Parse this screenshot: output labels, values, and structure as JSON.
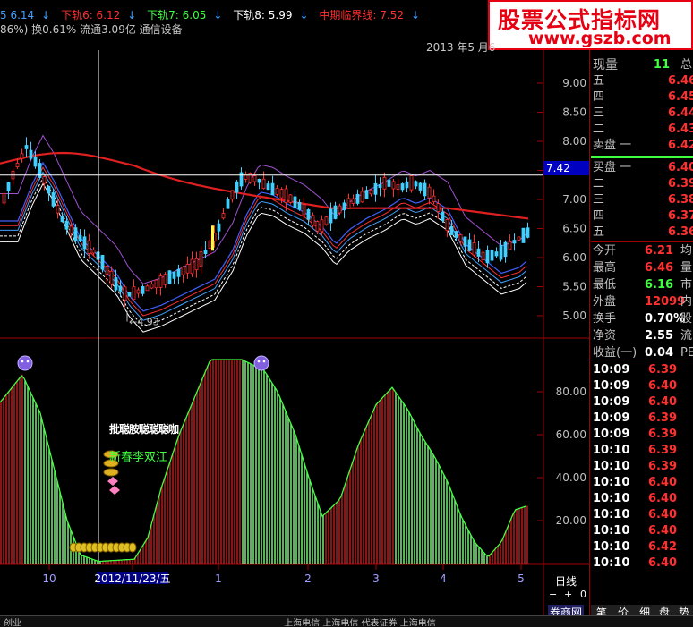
{
  "indicators": [
    {
      "text": "5 6.14",
      "color": "#40a0ff"
    },
    {
      "text": "下轨6: 6.12",
      "color": "#ff3030"
    },
    {
      "text": "下轨7: 6.05",
      "color": "#40ff40"
    },
    {
      "text": "下轨8: 5.99",
      "color": "#ffffff"
    },
    {
      "text": "中期临界线: 7.52",
      "color": "#ff3030"
    }
  ],
  "info_line": "86%) 换0.61% 流通3.09亿 通信设备",
  "watermark": {
    "line1": "股票公式指标网",
    "line2": "www.gszb.com"
  },
  "date_header": "2013 年5 月6",
  "price_axis": [
    "9.00",
    "8.50",
    "8.00",
    "7.50",
    "7.00",
    "6.50",
    "6.00",
    "5.50",
    "5.00"
  ],
  "crosshair_price": "7.42",
  "low_marker": "4.93",
  "osc_axis": [
    "80.00",
    "60.00",
    "40.00",
    "20.00"
  ],
  "time_labels": [
    "10",
    "2012/11/23/五",
    "1",
    "2",
    "3",
    "4",
    "5"
  ],
  "day_label": "日线",
  "overlay_texts": {
    "scribble": "批聪胺聪聪聪咖",
    "name": "新春李双江"
  },
  "quote": {
    "xianliang_label": "现量",
    "xianliang_value": "11",
    "zong": "总",
    "sell": [
      {
        "label": "五",
        "price": "6.46"
      },
      {
        "label": "四",
        "price": "6.45"
      },
      {
        "label": "三",
        "price": "6.44"
      },
      {
        "label": "二",
        "price": "6.43"
      },
      {
        "label": "卖盘 一",
        "price": "6.42"
      }
    ],
    "buy": [
      {
        "label": "买盘 一",
        "price": "6.40"
      },
      {
        "label": "二",
        "price": "6.39"
      },
      {
        "label": "三",
        "price": "6.38"
      },
      {
        "label": "四",
        "price": "6.37"
      },
      {
        "label": "五",
        "price": "6.36"
      }
    ],
    "stats": [
      {
        "label": "今开",
        "value": "6.21",
        "extra": "均",
        "color": "#ff3030"
      },
      {
        "label": "最高",
        "value": "6.46",
        "extra": "量",
        "color": "#ff3030"
      },
      {
        "label": "最低",
        "value": "6.16",
        "extra": "市",
        "color": "#40ff40"
      },
      {
        "label": "外盘",
        "value": "12099",
        "extra": "内",
        "color": "#ff3030"
      },
      {
        "label": "换手",
        "value": "0.70%",
        "extra": "股",
        "color": "#ffffff"
      },
      {
        "label": "净资",
        "value": "2.55",
        "extra": "流",
        "color": "#ffffff"
      },
      {
        "label": "收益(一)",
        "value": "0.04",
        "extra": "PE",
        "color": "#ffffff"
      }
    ]
  },
  "ticks": [
    {
      "time": "10:09",
      "price": "6.39"
    },
    {
      "time": "10:09",
      "price": "6.40"
    },
    {
      "time": "10:09",
      "price": "6.40"
    },
    {
      "time": "10:09",
      "price": "6.39"
    },
    {
      "time": "10:09",
      "price": "6.39"
    },
    {
      "time": "10:10",
      "price": "6.39"
    },
    {
      "time": "10:10",
      "price": "6.39"
    },
    {
      "time": "10:10",
      "price": "6.40"
    },
    {
      "time": "10:10",
      "price": "6.40"
    },
    {
      "time": "10:10",
      "price": "6.40"
    },
    {
      "time": "10:10",
      "price": "6.40"
    },
    {
      "time": "10:10",
      "price": "6.42"
    },
    {
      "time": "10:10",
      "price": "6.40"
    }
  ],
  "bottom_tabs": [
    "笔",
    "价",
    "细",
    "盘",
    "势"
  ],
  "broker": "券商网",
  "bottom_items": [
    "创业",
    "上海电信",
    "上海电信",
    "代表证券",
    "上海电信"
  ]
}
